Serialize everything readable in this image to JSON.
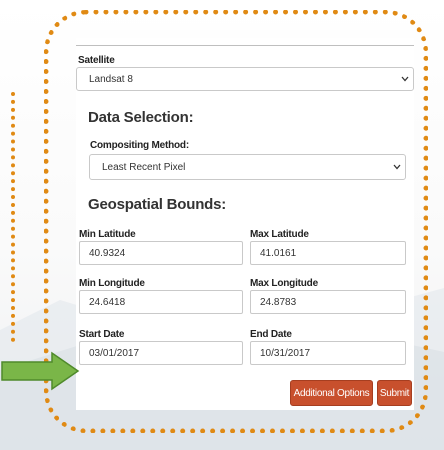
{
  "satellite": {
    "label": "Satellite",
    "value": "Landsat 8"
  },
  "data_selection": {
    "heading": "Data Selection:",
    "compositing_label": "Compositing Method:",
    "compositing_value": "Least Recent Pixel"
  },
  "geo_bounds": {
    "heading": "Geospatial Bounds:",
    "min_lat_label": "Min Latitude",
    "min_lat_value": "40.9324",
    "max_lat_label": "Max Latitude",
    "max_lat_value": "41.0161",
    "min_lon_label": "Min Longitude",
    "min_lon_value": "24.6418",
    "max_lon_label": "Max Longitude",
    "max_lon_value": "24.8783",
    "start_date_label": "Start Date",
    "start_date_value": "03/01/2017",
    "end_date_label": "End Date",
    "end_date_value": "10/31/2017"
  },
  "buttons": {
    "additional_options": "Additional Options",
    "submit": "Submit"
  },
  "colors": {
    "accent": "#c8502d",
    "highlight_border": "#e08a14",
    "arrow": "#7ab648"
  },
  "icons": {
    "dropdown": "chevron-down-icon",
    "pointer": "arrow-right-icon"
  }
}
